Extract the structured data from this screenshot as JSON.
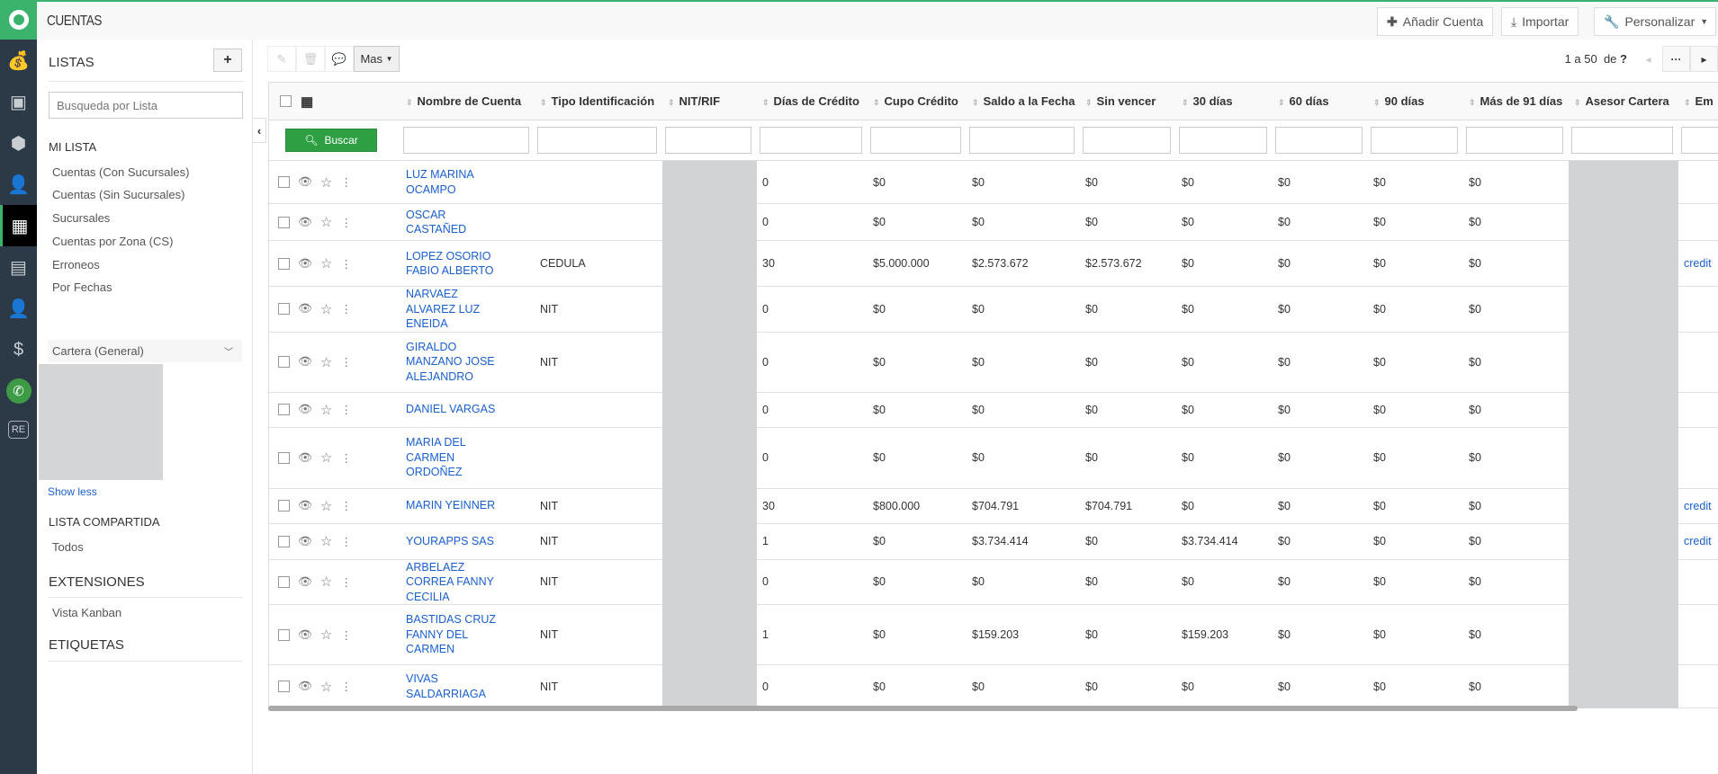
{
  "app": {
    "title": "CUENTAS",
    "nav_icons": [
      "money-bag-icon",
      "contact-card-icon",
      "box-icon",
      "user-icon",
      "buildings-icon",
      "calculator-money-icon",
      "user-tie-icon",
      "hand-money-icon",
      "whatsapp-icon",
      "re-badge-icon"
    ],
    "nav_re": "RE",
    "accent": "#3bb36c"
  },
  "topbar": {
    "add": "Añadir Cuenta",
    "import": "Importar",
    "customize": "Personalizar"
  },
  "sidebar": {
    "lists_title": "LISTAS",
    "search_placeholder": "Busqueda por Lista",
    "mi_lista": "MI LISTA",
    "items": [
      "Cuentas (Con Sucursales)",
      "Cuentas (Sin Sucursales)",
      "Sucursales",
      "Cuentas por Zona (CS)",
      "Erroneos",
      "Por Fechas"
    ],
    "selected": "Cartera (General)",
    "show_less": "Show less",
    "shared_title": "LISTA COMPARTIDA",
    "shared_items": [
      "Todos"
    ],
    "extensions_title": "EXTENSIONES",
    "extensions_items": [
      "Vista Kanban"
    ],
    "tags_title": "ETIQUETAS"
  },
  "toolbar": {
    "more": "Mas",
    "pager": "1 a 50",
    "pager_of": "de",
    "pager_total": "?"
  },
  "table": {
    "search_button": "Buscar",
    "columns": [
      "Nombre de Cuenta",
      "Tipo Identificación",
      "NIT/RIF",
      "Días de Crédito",
      "Cupo Crédito",
      "Saldo a la Fecha",
      "Sin vencer",
      "30 días",
      "60 días",
      "90 días",
      "Más de 91 días",
      "Asesor Cartera",
      "Em"
    ],
    "rows": [
      [
        "LUZ MARINA OCAMPO",
        "",
        "",
        "0",
        "$0",
        "$0",
        "$0",
        "$0",
        "$0",
        "$0",
        "$0",
        "",
        ""
      ],
      [
        "OSCAR CASTAÑED",
        "",
        "",
        "0",
        "$0",
        "$0",
        "$0",
        "$0",
        "$0",
        "$0",
        "$0",
        "",
        ""
      ],
      [
        "LOPEZ OSORIO FABIO ALBERTO",
        "CEDULA",
        "",
        "30",
        "$5.000.000",
        "$2.573.672",
        "$2.573.672",
        "$0",
        "$0",
        "$0",
        "$0",
        "",
        "credit"
      ],
      [
        "NARVAEZ ALVAREZ LUZ ENEIDA",
        "NIT",
        "",
        "0",
        "$0",
        "$0",
        "$0",
        "$0",
        "$0",
        "$0",
        "$0",
        "",
        ""
      ],
      [
        "GIRALDO MANZANO JOSE ALEJANDRO",
        "NIT",
        "",
        "0",
        "$0",
        "$0",
        "$0",
        "$0",
        "$0",
        "$0",
        "$0",
        "",
        ""
      ],
      [
        "DANIEL VARGAS",
        "",
        "",
        "0",
        "$0",
        "$0",
        "$0",
        "$0",
        "$0",
        "$0",
        "$0",
        "",
        ""
      ],
      [
        "MARIA DEL CARMEN ORDOÑEZ",
        "",
        "",
        "0",
        "$0",
        "$0",
        "$0",
        "$0",
        "$0",
        "$0",
        "$0",
        "",
        ""
      ],
      [
        "MARIN YEINNER",
        "NIT",
        "",
        "30",
        "$800.000",
        "$704.791",
        "$704.791",
        "$0",
        "$0",
        "$0",
        "$0",
        "",
        "credit"
      ],
      [
        "YOURAPPS SAS",
        "NIT",
        "",
        "1",
        "$0",
        "$3.734.414",
        "$0",
        "$3.734.414",
        "$0",
        "$0",
        "$0",
        "",
        "credit"
      ],
      [
        "ARBELAEZ CORREA FANNY CECILIA",
        "NIT",
        "",
        "0",
        "$0",
        "$0",
        "$0",
        "$0",
        "$0",
        "$0",
        "$0",
        "",
        ""
      ],
      [
        "BASTIDAS CRUZ FANNY DEL CARMEN",
        "NIT",
        "",
        "1",
        "$0",
        "$159.203",
        "$0",
        "$159.203",
        "$0",
        "$0",
        "$0",
        "",
        ""
      ],
      [
        "VIVAS SALDARRIAGA",
        "NIT",
        "",
        "0",
        "$0",
        "$0",
        "$0",
        "$0",
        "$0",
        "$0",
        "$0",
        "",
        ""
      ]
    ]
  }
}
